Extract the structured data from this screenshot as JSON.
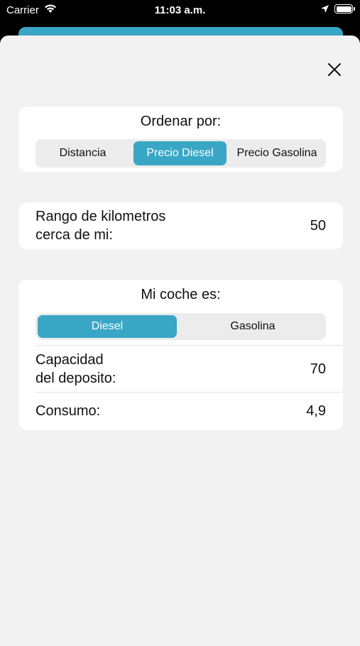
{
  "status_bar": {
    "carrier": "Carrier",
    "time": "11:03 a.m."
  },
  "sort_card": {
    "title": "Ordenar por:",
    "options": [
      "Distancia",
      "Precio Diesel",
      "Precio Gasolina"
    ],
    "selected": "Precio Diesel"
  },
  "range_card": {
    "label_line1": "Rango de kilometros",
    "label_line2": "cerca de mi:",
    "value": "50"
  },
  "car_card": {
    "title": "Mi coche es:",
    "options": [
      "Diesel",
      "Gasolina"
    ],
    "selected": "Diesel",
    "capacity_label_line1": "Capacidad",
    "capacity_label_line2": "del deposito:",
    "capacity_value": "70",
    "consumption_label": "Consumo:",
    "consumption_value": "4,9"
  },
  "colors": {
    "accent": "#3aa6c6",
    "sheet_background": "#f2f2f2",
    "card_background": "#ffffff"
  },
  "icons": [
    "wifi-icon",
    "location-arrow-icon",
    "battery-icon",
    "close-icon"
  ]
}
